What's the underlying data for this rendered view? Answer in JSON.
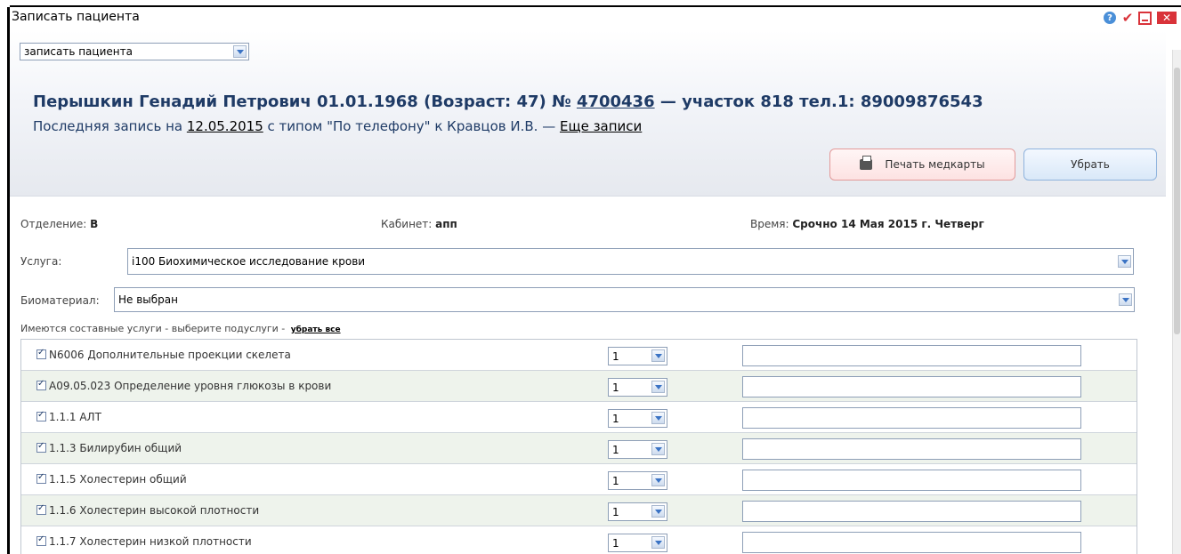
{
  "window": {
    "title": "Записать пациента"
  },
  "header": {
    "action_select": "записать пациента",
    "patient": {
      "name_dob_age": "Перышкин Генадий Петрович 01.01.1968 (Возраст: 47) № ",
      "card_number": "4700436",
      "area_phone": " — участок 818 тел.1: 89009876543"
    },
    "last_record": {
      "prefix": "Последняя запись на ",
      "date": "12.05.2015",
      "middle": " с типом \"По телефону\" к Кравцов И.В. — ",
      "more_link": "Еще записи"
    },
    "print_button": "Печать медкарты",
    "remove_button": "Убрать"
  },
  "info": {
    "department_label": "Отделение: ",
    "department_value": "В",
    "cabinet_label": "Кабинет: ",
    "cabinet_value": "апп",
    "time_label": "Время: ",
    "time_value": "Срочно 14 Мая 2015 г. Четверг"
  },
  "service": {
    "label": "Услуга:",
    "value": "i100 Биохимическое исследование крови"
  },
  "biomaterial": {
    "label": "Биоматериал:",
    "value": "Не выбран"
  },
  "subservices": {
    "note": "Имеются составные услуги - выберите подуслуги - ",
    "remove_all": "убрать все",
    "rows": [
      {
        "label": "N6006 Дополнительные проекции скелета",
        "qty": "1",
        "checked": true
      },
      {
        "label": "A09.05.023 Определение уровня глюкозы в крови",
        "qty": "1",
        "checked": true
      },
      {
        "label": "1.1.1 АЛТ",
        "qty": "1",
        "checked": true
      },
      {
        "label": "1.1.3 Билирубин общий",
        "qty": "1",
        "checked": true
      },
      {
        "label": "1.1.5 Холестерин общий",
        "qty": "1",
        "checked": true
      },
      {
        "label": "1.1.6 Холестерин высокой плотности",
        "qty": "1",
        "checked": true
      },
      {
        "label": "1.1.7 Холестерин низкой плотности",
        "qty": "1",
        "checked": true
      }
    ]
  }
}
